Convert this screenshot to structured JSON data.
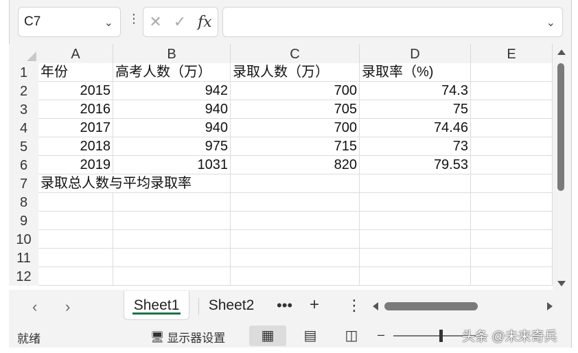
{
  "formula_bar": {
    "name_box": "C7",
    "fx_label": "fx",
    "formula_value": ""
  },
  "columns": [
    "A",
    "B",
    "C",
    "D",
    "E"
  ],
  "rows": [
    "1",
    "2",
    "3",
    "4",
    "5",
    "6",
    "7",
    "8",
    "9",
    "10",
    "11",
    "12"
  ],
  "cells": [
    [
      "年份",
      "高考人数（万）",
      "录取人数（万）",
      "录取率（%)"
    ],
    [
      "2015",
      "942",
      "700",
      "74.3"
    ],
    [
      "2016",
      "940",
      "705",
      "75"
    ],
    [
      "2017",
      "940",
      "700",
      "74.46"
    ],
    [
      "2018",
      "975",
      "715",
      "73"
    ],
    [
      "2019",
      "1031",
      "820",
      "79.53"
    ],
    [
      "录取总人数与平均录取率",
      "",
      "",
      ""
    ]
  ],
  "sheet_tabs": [
    "Sheet1",
    "Sheet2"
  ],
  "active_sheet": "Sheet1",
  "status_bar": {
    "ready": "就绪",
    "display_settings": "显示器设置"
  },
  "watermark": "头条 @未来奇兵",
  "colors": {
    "accent": "#1e7145"
  }
}
